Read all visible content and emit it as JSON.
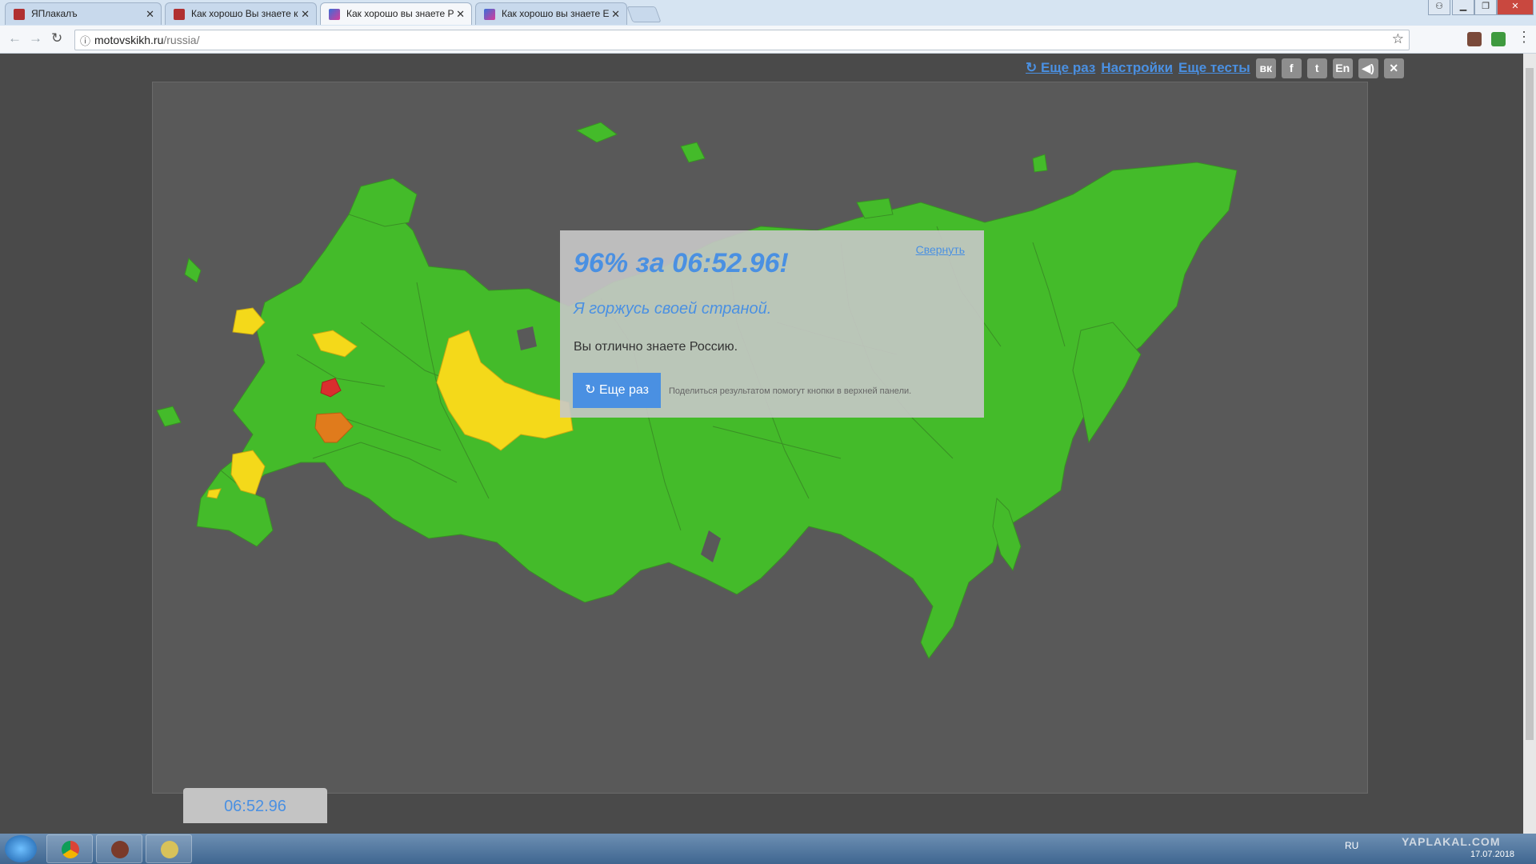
{
  "browser": {
    "tabs": [
      {
        "title": "ЯПлакалъ",
        "active": false
      },
      {
        "title": "Как хорошо Вы знаете к",
        "active": false
      },
      {
        "title": "Как хорошо вы знаете Р",
        "active": true
      },
      {
        "title": "Как хорошо вы знаете Е",
        "active": false
      }
    ],
    "address": {
      "host": "motovskikh.ru",
      "path": "/russia/"
    }
  },
  "page": {
    "nav": {
      "again": "↻ Еще раз",
      "settings": "Настройки",
      "more_tests": "Еще тесты"
    },
    "share_buttons": [
      {
        "icon": "vk-icon",
        "glyph": "вк"
      },
      {
        "icon": "facebook-icon",
        "glyph": "f"
      },
      {
        "icon": "twitter-icon",
        "glyph": "t"
      },
      {
        "icon": "language-en-icon",
        "glyph": "En"
      },
      {
        "icon": "sound-icon",
        "glyph": "◀)"
      },
      {
        "icon": "close-icon",
        "glyph": "✕"
      }
    ],
    "result": {
      "score": "96% за 06:52.96!",
      "slogan": "Я горжусь своей страной.",
      "verdict": "Вы отлично знаете Россию.",
      "collapse": "Свернуть",
      "again_button": "↻ Еще раз",
      "share_hint": "Поделиться результатом помогут кнопки в верхней панели."
    },
    "timer": "06:52.96",
    "map_colors": {
      "correct": "#44bb2a",
      "second_try": "#f4d91a",
      "third_try": "#e07b1c",
      "wrong": "#d92e2e",
      "background": "#595959"
    }
  },
  "taskbar": {
    "language": "RU",
    "date": "17.07.2018",
    "watermark": "YAPLAKAL.COM"
  }
}
